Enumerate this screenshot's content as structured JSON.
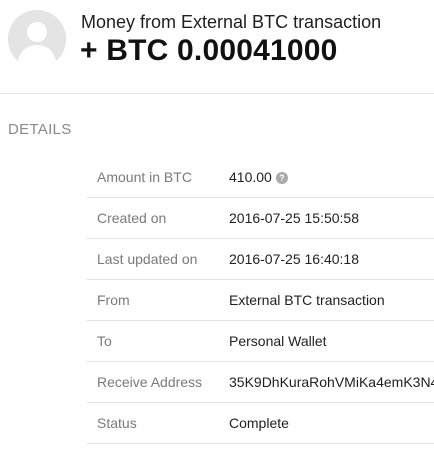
{
  "header": {
    "title": "Money from External BTC transaction",
    "amount": "+ BTC 0.00041000",
    "avatar_icon": "user-silhouette-icon"
  },
  "details": {
    "heading": "DETAILS",
    "help_glyph": "?",
    "rows": [
      {
        "label": "Amount in BTC",
        "value": "410.00"
      },
      {
        "label": "Created on",
        "value": "2016-07-25 15:50:58"
      },
      {
        "label": "Last updated on",
        "value": "2016-07-25 16:40:18"
      },
      {
        "label": "From",
        "value": "External BTC transaction"
      },
      {
        "label": "To",
        "value": "Personal Wallet"
      },
      {
        "label": "Receive Address",
        "value": "35K9DhKuraRohVMiKa4emK3N4"
      },
      {
        "label": "Status",
        "value": "Complete"
      }
    ]
  }
}
